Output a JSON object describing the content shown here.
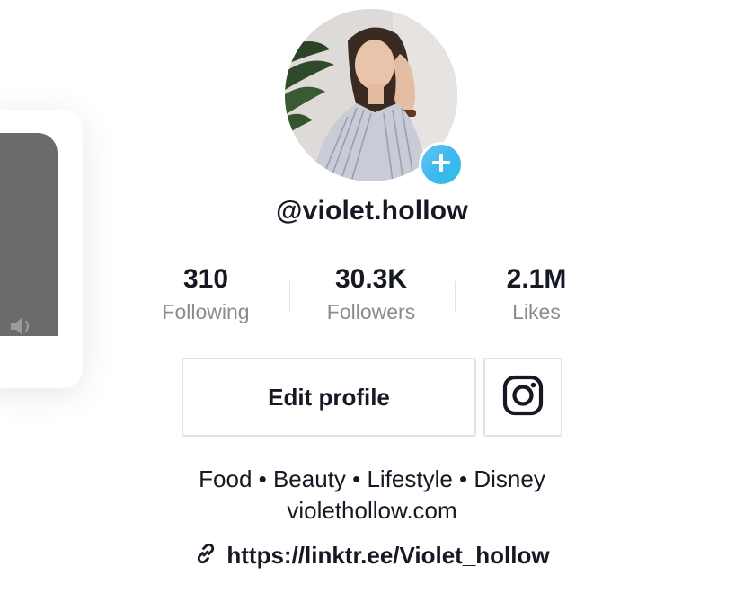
{
  "profile": {
    "username": "@violet.hollow",
    "avatar_icon": "profile-photo",
    "add_icon": "plus-icon",
    "accent_gradient": [
      "#5fc8f5",
      "#27c4de"
    ]
  },
  "stats": [
    {
      "value": "310",
      "label": "Following"
    },
    {
      "value": "30.3K",
      "label": "Followers"
    },
    {
      "value": "2.1M",
      "label": "Likes"
    }
  ],
  "actions": {
    "edit_profile_label": "Edit profile",
    "instagram_icon": "instagram-icon"
  },
  "bio": {
    "line1": "Food • Beauty • Lifestyle • Disney",
    "line2": "violethollow.com"
  },
  "link": {
    "icon": "link-icon",
    "text": "https://linktr.ee/Violet_hollow"
  },
  "side_preview": {
    "sound_icon": "speaker-icon"
  }
}
